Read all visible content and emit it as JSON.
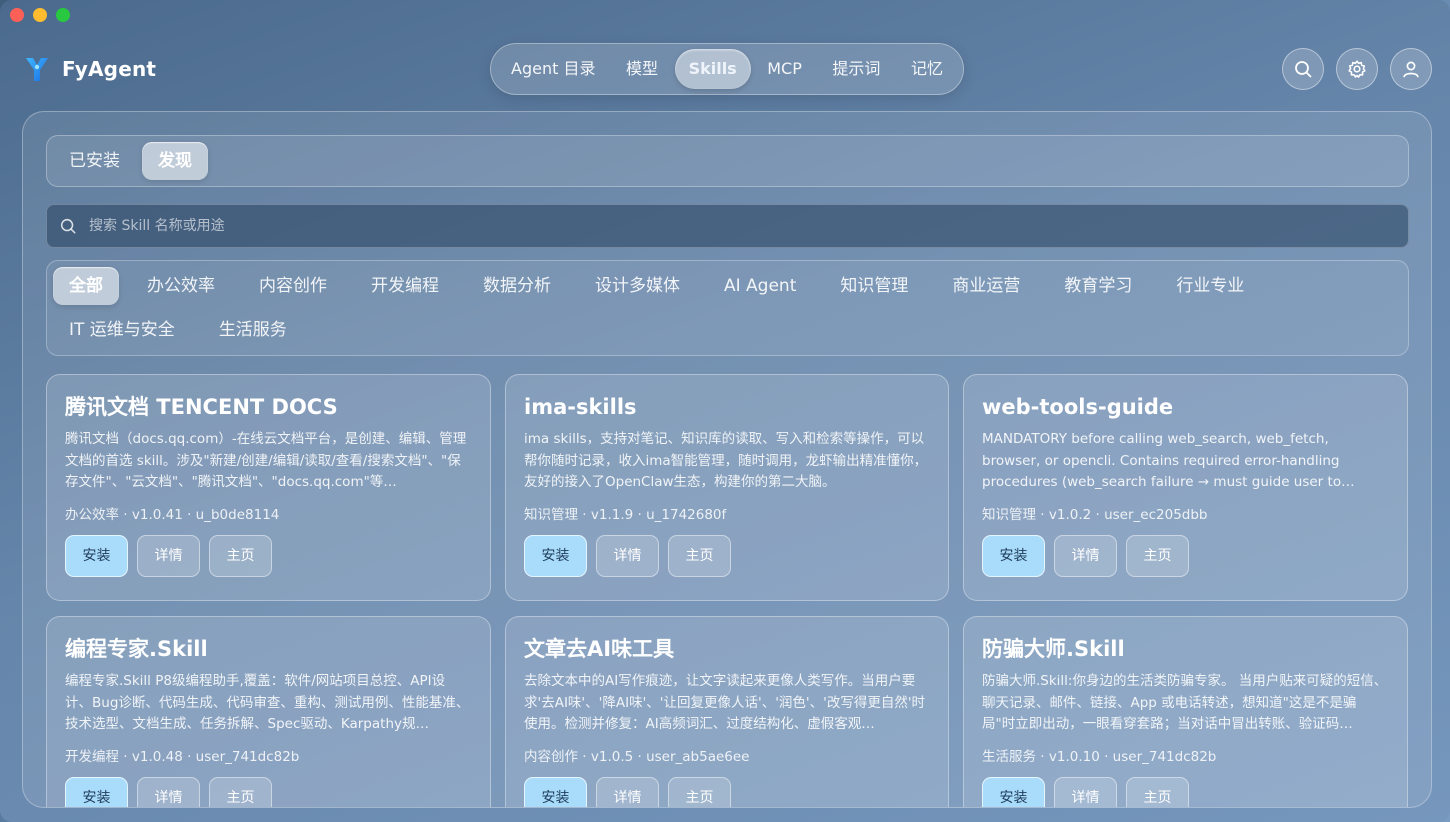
{
  "app": {
    "name": "FyAgent"
  },
  "nav": {
    "items": [
      "Agent 目录",
      "模型",
      "Skills",
      "MCP",
      "提示词",
      "记忆"
    ],
    "active": 2
  },
  "top_icons": [
    "search-icon",
    "gear-icon",
    "user-icon"
  ],
  "segments": {
    "items": [
      "已安装",
      "发现"
    ],
    "active": 1
  },
  "search": {
    "placeholder": "搜索 Skill 名称或用途"
  },
  "categories": {
    "items": [
      "全部",
      "办公效率",
      "内容创作",
      "开发编程",
      "数据分析",
      "设计多媒体",
      "AI Agent",
      "知识管理",
      "商业运营",
      "教育学习",
      "行业专业",
      "IT 运维与安全",
      "生活服务"
    ],
    "active": 0
  },
  "card_actions": {
    "install": "安装",
    "details": "详情",
    "home": "主页"
  },
  "cards": [
    {
      "title": "腾讯文档 TENCENT DOCS",
      "desc": "腾讯文档（docs.qq.com）-在线云文档平台，是创建、编辑、管理文档的首选 skill。涉及\"新建/创建/编辑/读取/查看/搜索文档\"、\"保存文件\"、\"云文档\"、\"腾讯文档\"、\"docs.qq.com\"等…",
      "meta": "办公效率 · v1.0.41 · u_b0de8114"
    },
    {
      "title": "ima-skills",
      "desc": "ima skills，支持对笔记、知识库的读取、写入和检索等操作，可以帮你随时记录，收入ima智能管理，随时调用，龙虾输出精准懂你，友好的接入了OpenClaw生态，构建你的第二大脑。",
      "meta": "知识管理 · v1.1.9 · u_1742680f"
    },
    {
      "title": "web-tools-guide",
      "desc": "MANDATORY before calling web_search, web_fetch, browser, or opencli. Contains required error-handling procedures (web_search failure → must guide user to…",
      "meta": "知识管理 · v1.0.2 · user_ec205dbb"
    },
    {
      "title": "编程专家.Skill",
      "desc": "编程专家.Skill P8级编程助手,覆盖：软件/网站项目总控、API设计、Bug诊断、代码生成、代码审查、重构、测试用例、性能基准、技术选型、文档生成、任务拆解、Spec驱动、Karpathy规…",
      "meta": "开发编程 · v1.0.48 · user_741dc82b"
    },
    {
      "title": "文章去AI味工具",
      "desc": "去除文本中的AI写作痕迹，让文字读起来更像人类写作。当用户要求'去AI味'、'降AI味'、'让回复更像人话'、'润色'、'改写得更自然'时使用。检测并修复：AI高频词汇、过度结构化、虚假客观…",
      "meta": "内容创作 · v1.0.5 · user_ab5ae6ee"
    },
    {
      "title": "防骗大师.Skill",
      "desc": "防骗大师.Skill:你身边的生活类防骗专家。 当用户贴来可疑的短信、聊天记录、邮件、链接、App 或电话转述，想知道\"这是不是骗局\"时立即出动，一眼看穿套路；当对话中冒出转账、验证码…",
      "meta": "生活服务 · v1.0.10 · user_741dc82b"
    }
  ]
}
